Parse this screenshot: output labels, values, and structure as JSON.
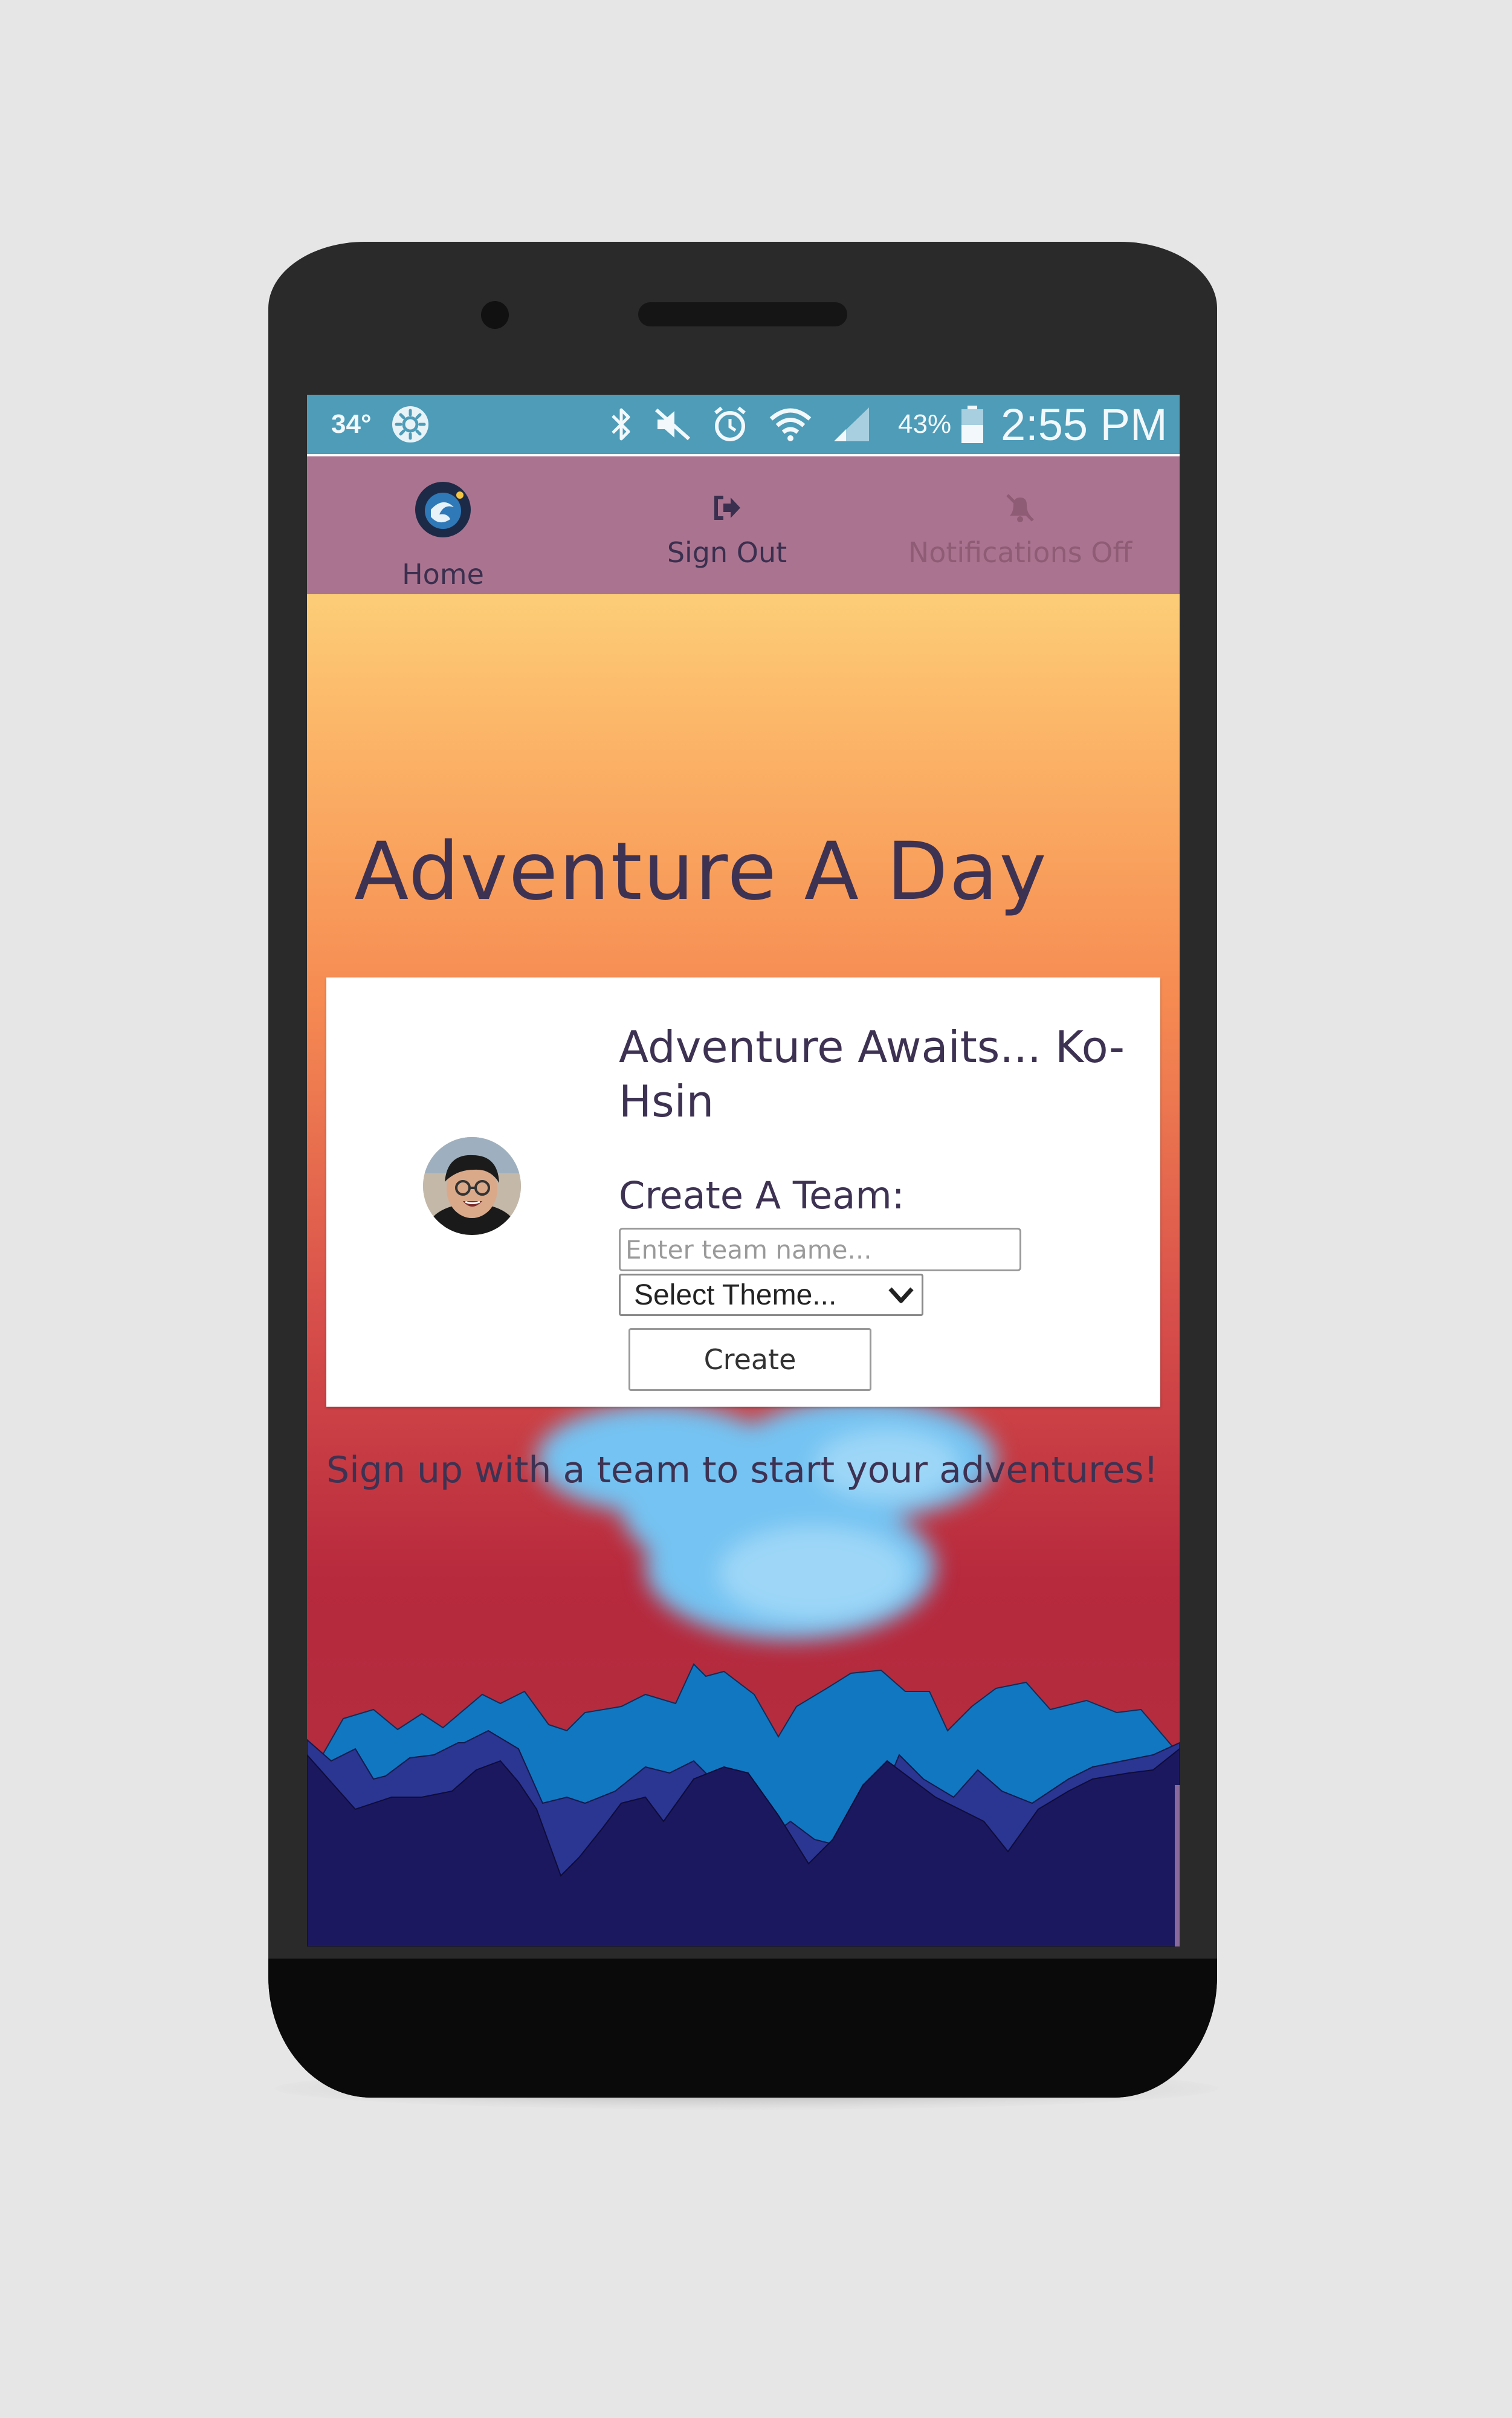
{
  "status_bar": {
    "temperature": "34°",
    "battery_percent": "43%",
    "time": "2:55 PM",
    "icons": [
      "weather-icon",
      "bluetooth-icon",
      "mute-icon",
      "alarm-icon",
      "wifi-icon",
      "signal-icon",
      "battery-icon"
    ]
  },
  "nav": {
    "home_label": "Home",
    "signout_label": "Sign Out",
    "notifications_label": "Notifications Off"
  },
  "hero": {
    "title": "Adventure A Day"
  },
  "card": {
    "greeting": "Adventure Awaits... Ko-Hsin",
    "create_team_label": "Create A Team:",
    "team_name_placeholder": "Enter team name...",
    "theme_select_value": "Select Theme...",
    "create_button_label": "Create"
  },
  "footer": {
    "signup_text": "Sign up with a team to start your adventures!"
  },
  "colors": {
    "status_bar": "#4e9cb8",
    "nav_bar": "#aa7490",
    "text": "#3e3253",
    "gradient_top": "#fde7a5",
    "gradient_bottom": "#b7293d",
    "mountain_light": "#1177c0",
    "mountain_mid": "#2b3592",
    "mountain_dark": "#1c1860"
  }
}
